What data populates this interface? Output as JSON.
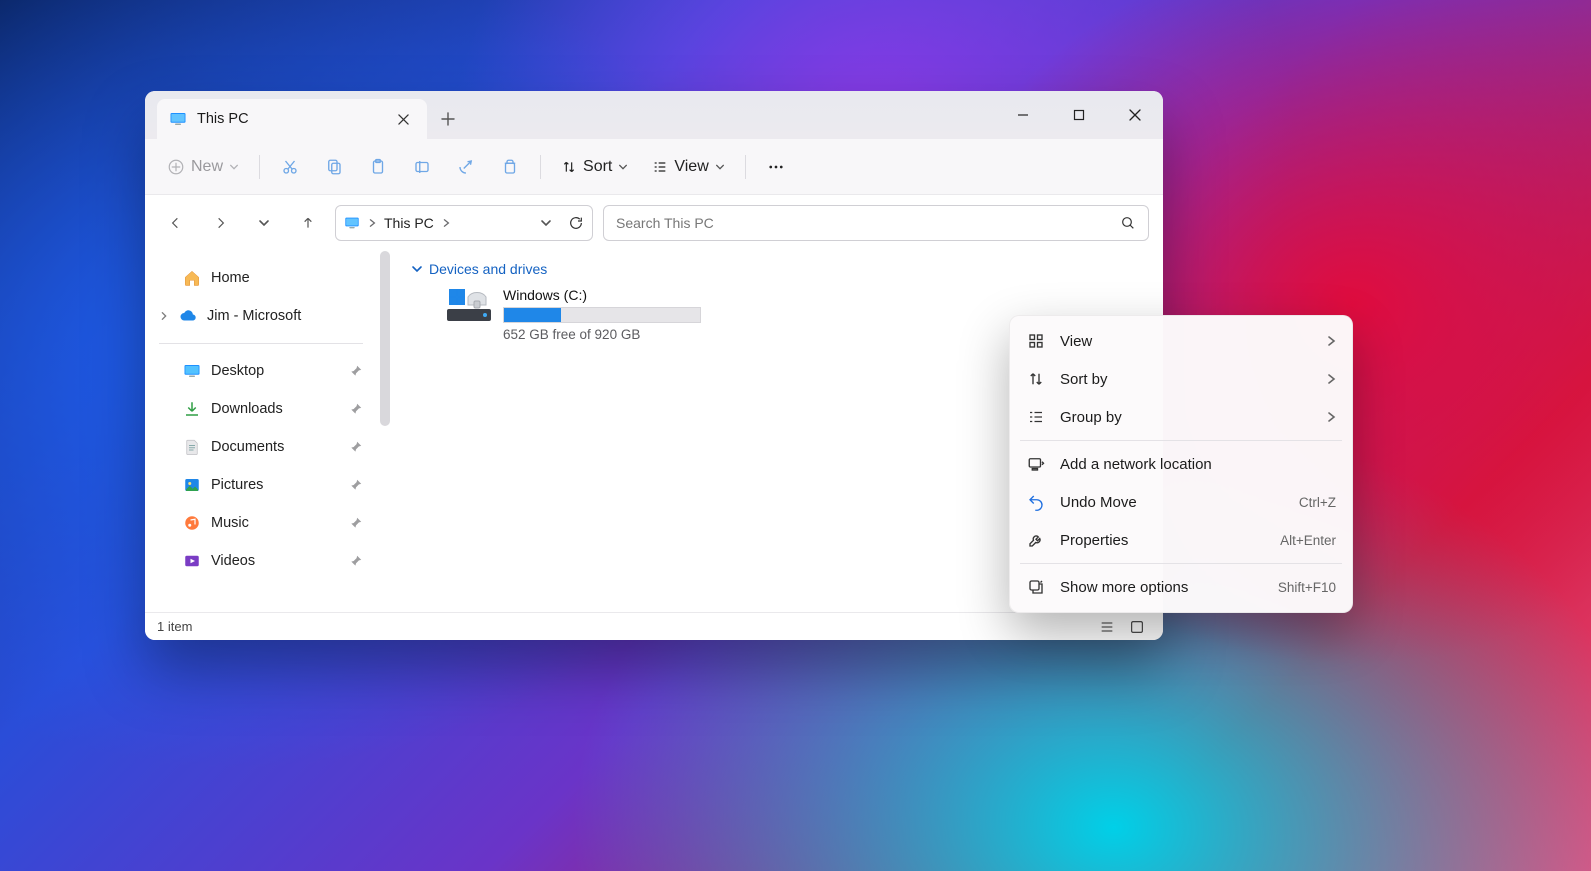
{
  "tab": {
    "title": "This PC"
  },
  "toolbar": {
    "new_label": "New",
    "sort_label": "Sort",
    "view_label": "View"
  },
  "address": {
    "location": "This PC"
  },
  "search": {
    "placeholder": "Search This PC"
  },
  "sidebar": {
    "home": "Home",
    "cloud": "Jim - Microsoft",
    "quick": [
      {
        "label": "Desktop",
        "icon": "desktop"
      },
      {
        "label": "Downloads",
        "icon": "downloads"
      },
      {
        "label": "Documents",
        "icon": "documents"
      },
      {
        "label": "Pictures",
        "icon": "pictures"
      },
      {
        "label": "Music",
        "icon": "music"
      },
      {
        "label": "Videos",
        "icon": "videos"
      }
    ]
  },
  "content": {
    "group_label": "Devices and drives",
    "drive": {
      "name": "Windows  (C:)",
      "free_text": "652 GB free of 920 GB",
      "used_fraction": 0.29
    }
  },
  "statusbar": {
    "text": "1 item"
  },
  "context_menu": {
    "items": [
      {
        "icon": "grid",
        "label": "View",
        "submenu": true
      },
      {
        "icon": "sort",
        "label": "Sort by",
        "submenu": true
      },
      {
        "icon": "group",
        "label": "Group by",
        "submenu": true
      },
      {
        "sep": true
      },
      {
        "icon": "netloc",
        "label": "Add a network location"
      },
      {
        "icon": "undo",
        "label": "Undo Move",
        "shortcut": "Ctrl+Z"
      },
      {
        "icon": "wrench",
        "label": "Properties",
        "shortcut": "Alt+Enter"
      },
      {
        "sep": true
      },
      {
        "icon": "more",
        "label": "Show more options",
        "shortcut": "Shift+F10"
      }
    ]
  }
}
